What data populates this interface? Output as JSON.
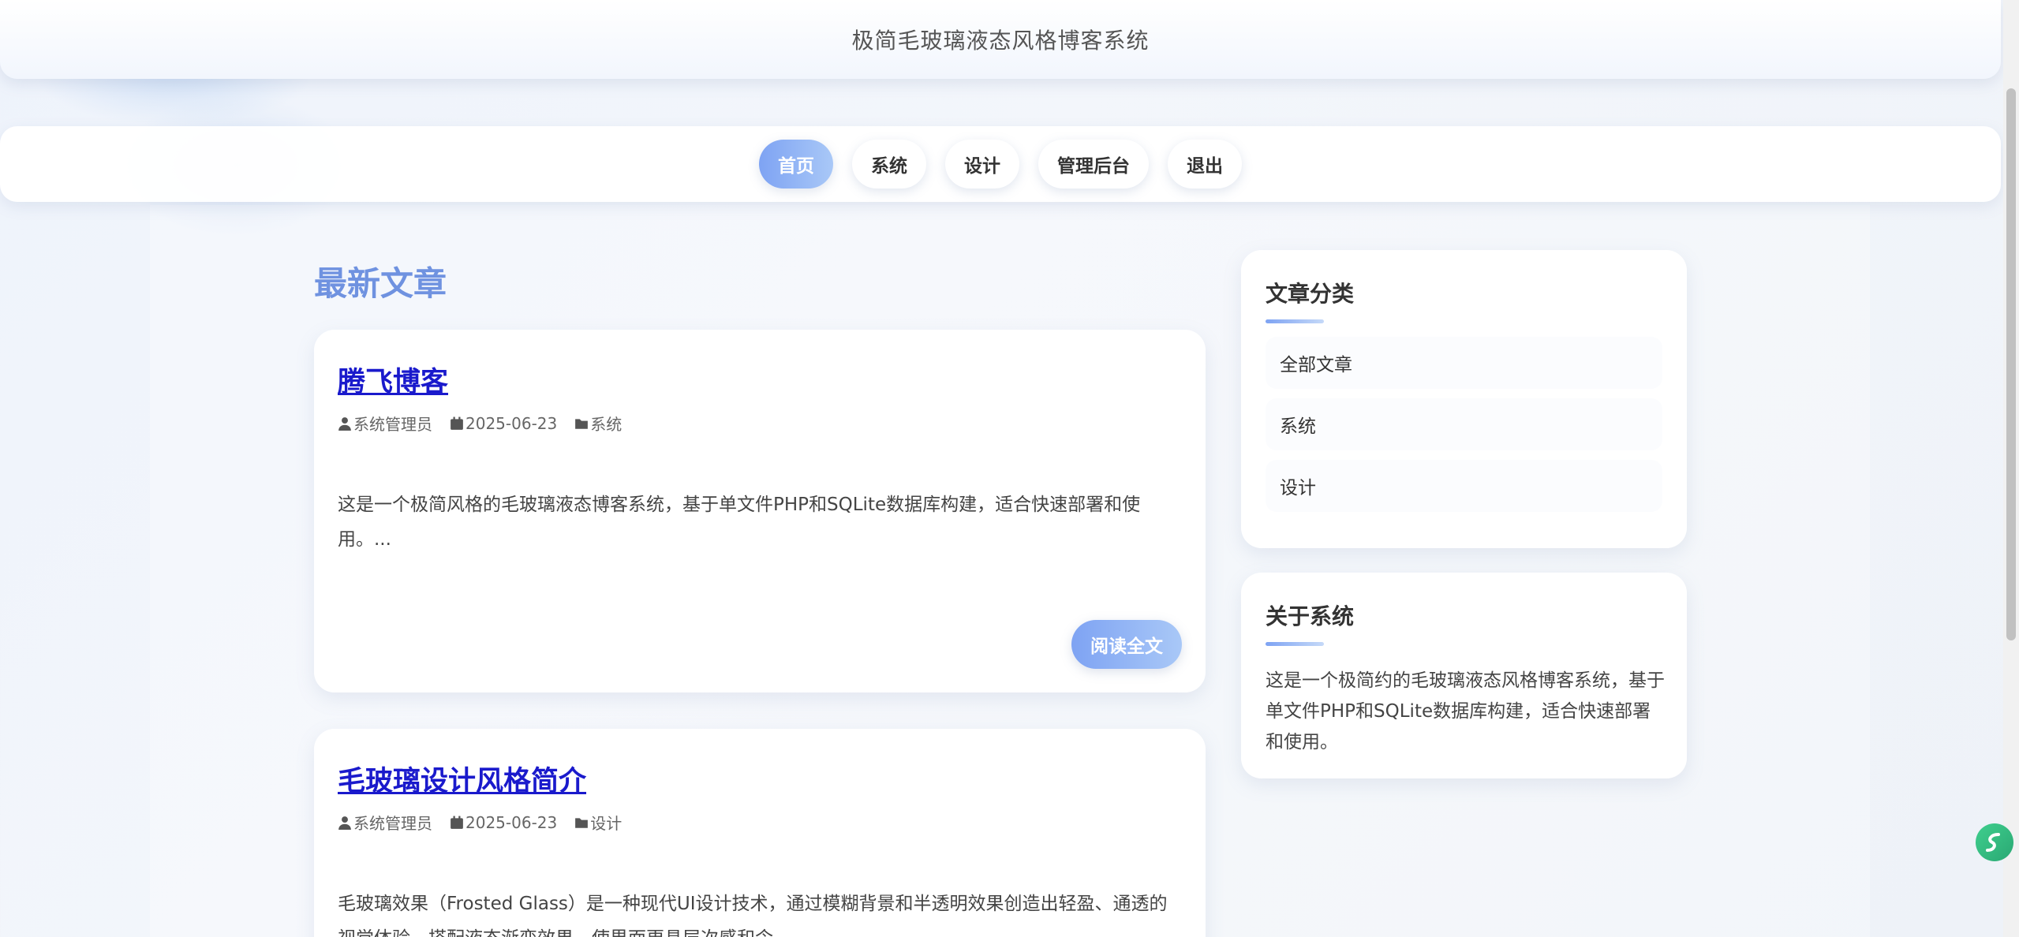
{
  "header": {
    "site_title": "极简毛玻璃液态风格博客系统"
  },
  "nav": {
    "items": [
      {
        "label": "首页",
        "active": true
      },
      {
        "label": "系统"
      },
      {
        "label": "设计"
      },
      {
        "label": "管理后台"
      },
      {
        "label": "退出"
      }
    ]
  },
  "main": {
    "section_title": "最新文章",
    "posts": [
      {
        "title": "腾飞博客",
        "author": "系统管理员",
        "date": "2025-06-23",
        "category": "系统",
        "excerpt": "这是一个极简风格的毛玻璃液态博客系统，基于单文件PHP和SQLite数据库构建，适合快速部署和使用。...",
        "read_more": "阅读全文"
      },
      {
        "title": "毛玻璃设计风格简介",
        "author": "系统管理员",
        "date": "2025-06-23",
        "category": "设计",
        "excerpt": "毛玻璃效果（Frosted Glass）是一种现代UI设计技术，通过模糊背景和半透明效果创造出轻盈、通透的视觉体验。搭配液态渐变效果，使界面更具层次感和令"
      }
    ]
  },
  "sidebar": {
    "categories": {
      "title": "文章分类",
      "items": [
        "全部文章",
        "系统",
        "设计"
      ]
    },
    "about": {
      "title": "关于系统",
      "text": "这是一个极简约的毛玻璃液态风格博客系统，基于单文件PHP和SQLite数据库构建，适合快速部署和使用。"
    }
  },
  "colors": {
    "accent": "#7ea3f3",
    "title_blue": "#6f92e0",
    "link": "#1a1acc"
  },
  "icons": {
    "author": "user-icon",
    "date": "calendar-icon",
    "category": "folder-icon"
  }
}
